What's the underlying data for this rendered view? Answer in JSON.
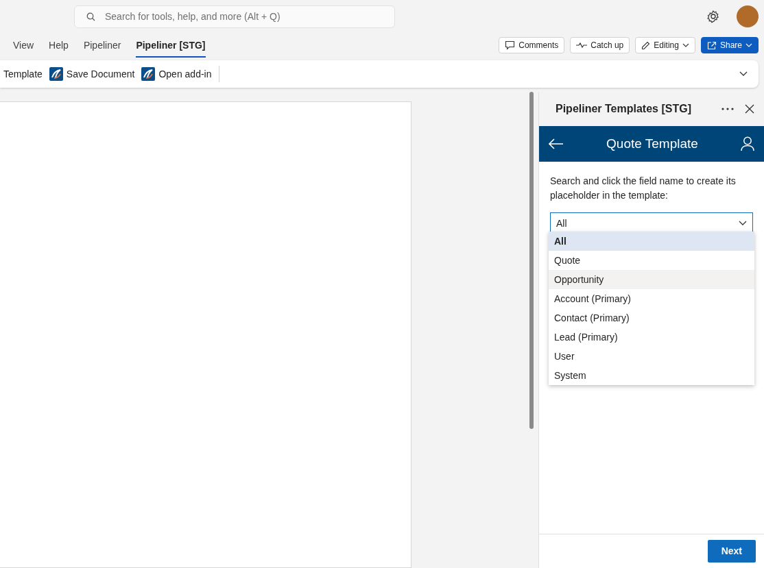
{
  "search": {
    "placeholder": "Search for tools, help, and more (Alt + Q)"
  },
  "tabs": [
    {
      "label": "View",
      "selected": false
    },
    {
      "label": "Help",
      "selected": false
    },
    {
      "label": "Pipeliner",
      "selected": false
    },
    {
      "label": "Pipeliner [STG]",
      "selected": true
    }
  ],
  "header_buttons": [
    {
      "kind": "comments",
      "label": "Comments"
    },
    {
      "kind": "catchup",
      "label": "Catch up"
    },
    {
      "kind": "editing",
      "label": "Editing"
    },
    {
      "kind": "share",
      "label": "Share"
    }
  ],
  "ribbon": [
    {
      "label": "Template",
      "icon": false
    },
    {
      "label": "Save Document",
      "icon": true
    },
    {
      "label": "Open add-in",
      "icon": true
    }
  ],
  "pane": {
    "title": "Pipeliner Templates [STG]",
    "header": "Quote Template",
    "instruction": "Search and click the field name to create its placeholder in the template:",
    "select_value": "All",
    "options": [
      {
        "label": "All",
        "selected": true,
        "hovered": false
      },
      {
        "label": "Quote",
        "selected": false,
        "hovered": false
      },
      {
        "label": "Opportunity",
        "selected": false,
        "hovered": true
      },
      {
        "label": "Account (Primary)",
        "selected": false,
        "hovered": false
      },
      {
        "label": "Contact (Primary)",
        "selected": false,
        "hovered": false
      },
      {
        "label": "Lead (Primary)",
        "selected": false,
        "hovered": false
      },
      {
        "label": "User",
        "selected": false,
        "hovered": false
      },
      {
        "label": "System",
        "selected": false,
        "hovered": false
      }
    ],
    "next_button": "Next"
  }
}
